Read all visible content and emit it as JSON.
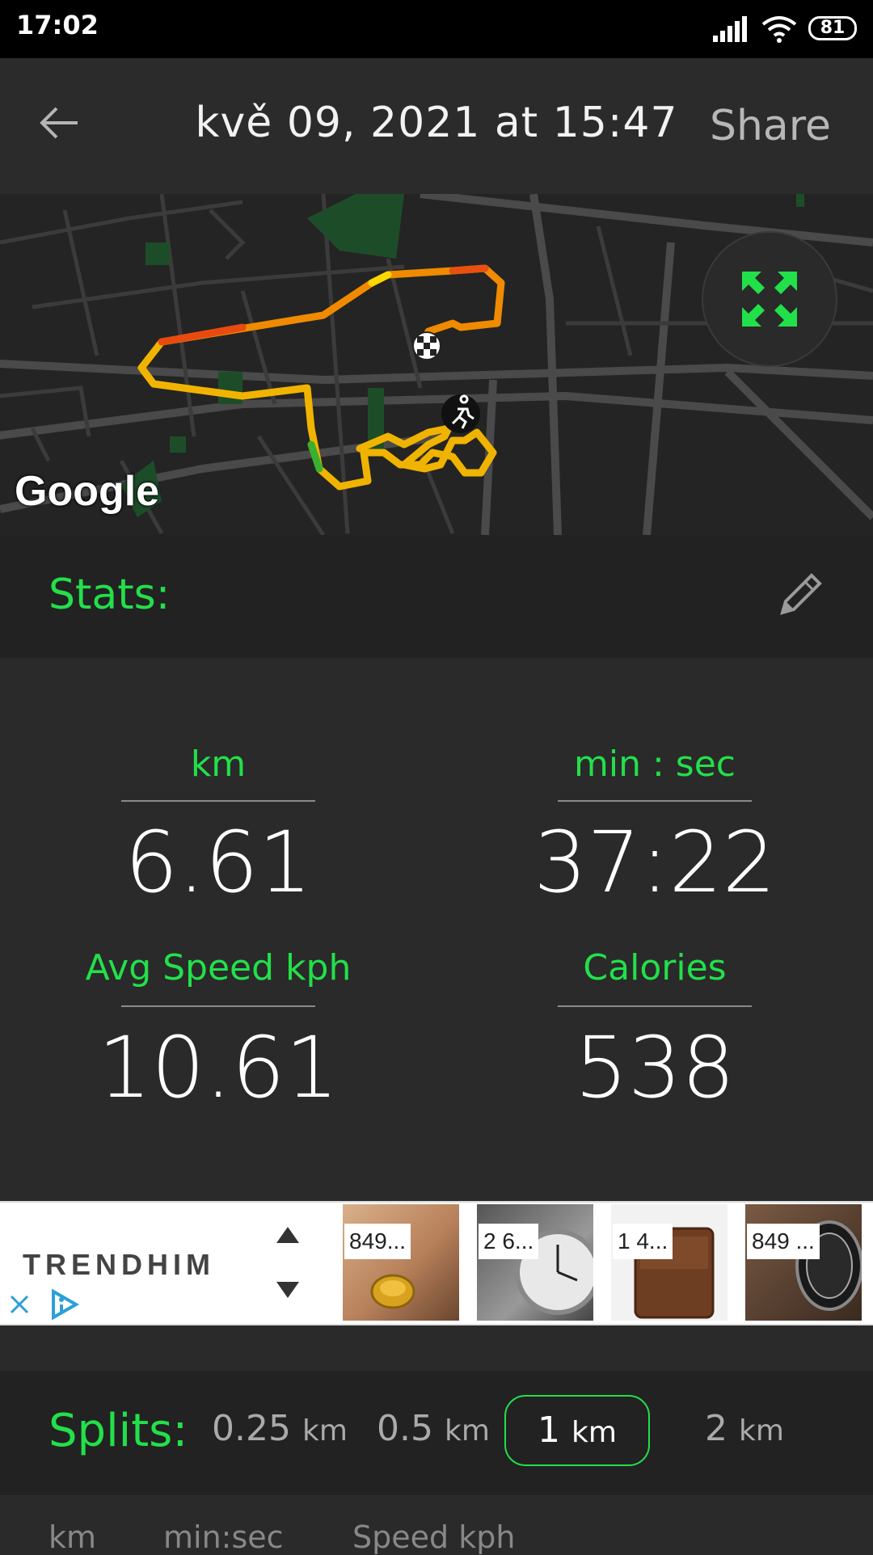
{
  "status_bar": {
    "time": "17:02",
    "battery": "81"
  },
  "header": {
    "title": "kvě 09, 2021 at 15:47",
    "share_label": "Share"
  },
  "map": {
    "attribution": "Google"
  },
  "stats": {
    "section_label": "Stats:",
    "items": [
      {
        "label": "km",
        "value": "6.61"
      },
      {
        "label": "min : sec",
        "value": "37:22"
      },
      {
        "label": "Avg Speed kph",
        "value": "10.61"
      },
      {
        "label": "Calories",
        "value": "538"
      }
    ]
  },
  "ad": {
    "brand": "TRENDHIM",
    "products": [
      {
        "price": "849..."
      },
      {
        "price": "2 6..."
      },
      {
        "price": "1 4..."
      },
      {
        "price": "849 ..."
      }
    ]
  },
  "splits": {
    "label": "Splits:",
    "options": [
      {
        "value": "0.25",
        "unit": "km"
      },
      {
        "value": "0.5",
        "unit": "km"
      },
      {
        "value": "1",
        "unit": "km"
      },
      {
        "value": "2",
        "unit": "km"
      }
    ],
    "selected": "1 km"
  },
  "table": {
    "columns": [
      "km",
      "min:sec",
      "Speed kph"
    ]
  },
  "colors": {
    "accent": "#22e04a",
    "background": "#2a2a2a"
  }
}
